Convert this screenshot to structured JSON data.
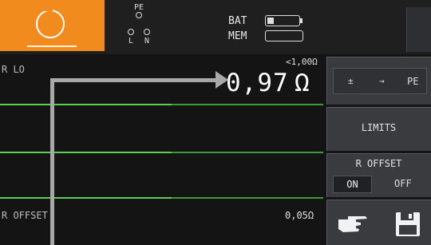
{
  "header": {
    "probe_pe": "PE",
    "probe_l": "L",
    "probe_n": "N",
    "bat_label": "BAT",
    "mem_label": "MEM",
    "mode_icon": "rotary-dial-icon"
  },
  "readings": {
    "rlo_label": "R LO",
    "rlo_limit": "<1,00Ω",
    "rlo_value": "0,97",
    "rlo_unit": "Ω",
    "roffset_label": "R OFFSET",
    "roffset_value": "0,05Ω"
  },
  "softkeys": {
    "pe_plus_minus": "±",
    "pe_arrow": "→",
    "pe_label": "PE",
    "limits_label": "LIMITS",
    "roffset_title": "R OFFSET",
    "roffset_on": "ON",
    "roffset_off": "OFF",
    "hand_icon": "pointing-hand-icon",
    "save_icon": "floppy-disk-icon"
  },
  "colors": {
    "accent": "#f28b1d",
    "separator": "#3a9a3a",
    "softkey_bg": "#3a3b3f"
  }
}
